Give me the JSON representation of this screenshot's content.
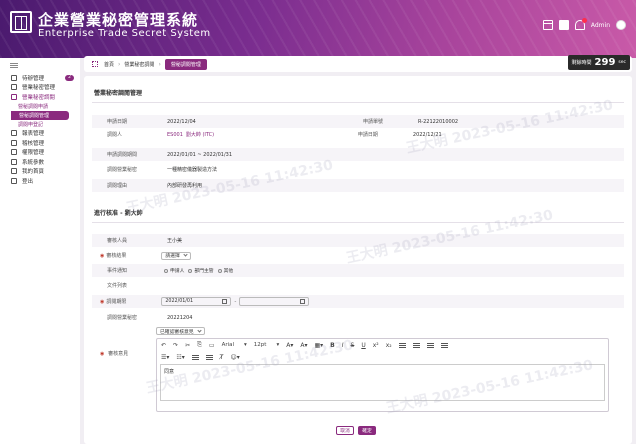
{
  "header": {
    "title": "企業營業秘密管理系統",
    "subtitle": "Enterprise Trade Secret System",
    "user": "Admin"
  },
  "sidebar": {
    "items": [
      {
        "label": "待辦管理",
        "count": "2"
      },
      {
        "label": "營業秘密管理"
      },
      {
        "label": "營業秘密調閱",
        "active": true
      }
    ],
    "subs": [
      "營秘調閱申請",
      "營秘調閱管理",
      "調閱申登記"
    ],
    "more": [
      "報表管理",
      "稽核管理",
      "權限管理",
      "系統參數",
      "我的首頁",
      "登出"
    ]
  },
  "topbar": {
    "crumbs": [
      "首頁",
      "營業秘密調閱",
      "營秘調閱管理"
    ],
    "timer_label": "剩餘時間",
    "timer_value": "299",
    "timer_unit": "sec"
  },
  "main": {
    "section1_title": "營業秘密調閱管理",
    "apply_date_label": "申請日期",
    "apply_date": "2022/12/04",
    "apply_no_label": "申請單號",
    "apply_no": "R-22122010002",
    "applicant_label": "調閱人",
    "applicant_id": "ES001",
    "applicant_name": "劉大帥 (ITC)",
    "apply_time_label": "申請日期",
    "apply_time": "2022/12/21",
    "period_label": "申請調閱期間",
    "period": "2022/01/01 ~ 2022/01/31",
    "secret_label": "調閱營業秘密",
    "secret": "一種精密儀器製造方法",
    "purpose_label": "調閱理由",
    "purpose": "內部研發再利用",
    "section2_title": "進行核准 - 劉大帥",
    "approver_label": "審核人員",
    "approver": "王小美",
    "result_label": "審核結果",
    "result": "請選擇",
    "notify_label": "事件通知",
    "notify_opts": [
      "申請人",
      "部門主管",
      "其他"
    ],
    "docs_label": "文件列表",
    "date_label": "調閱期限",
    "date_from": "2022/01/01",
    "secret2_label": "調閱營業秘密",
    "secret2": "20221204",
    "opinion_select": "已確認審核意見",
    "opinion_label": "審核意見",
    "font": "Arial",
    "size": "12pt",
    "opinion_text": "同意",
    "cancel": "取消",
    "ok": "確定"
  },
  "watermark": "王大明  2023-05-16 11:42:30"
}
